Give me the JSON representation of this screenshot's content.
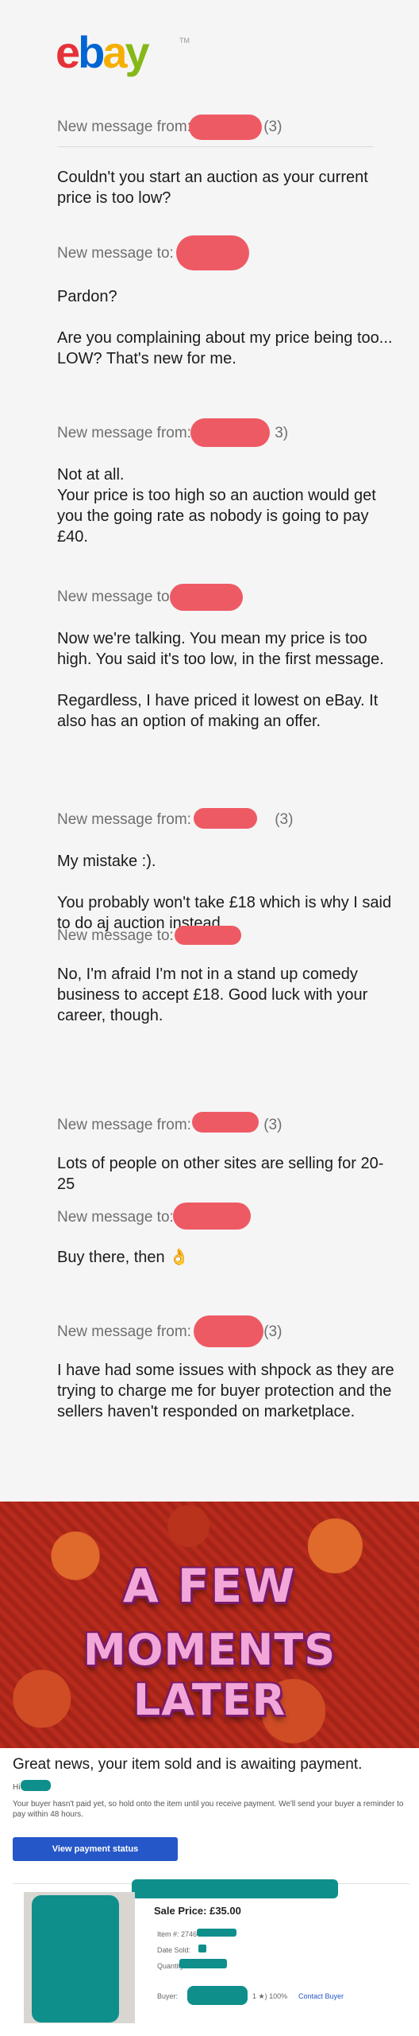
{
  "logo": {
    "letters": [
      "e",
      "b",
      "a",
      "y"
    ],
    "letter_colors": [
      "#e53238",
      "#0064d2",
      "#f5af02",
      "#86b817"
    ],
    "tm": "TM"
  },
  "conversation": [
    {
      "header": "New message from:",
      "suffix": "(3)",
      "text": "Couldn't you start an auction as your current price is too low?"
    },
    {
      "header": "New message to:",
      "suffix": "",
      "text": "Pardon?\n\nAre you complaining about my price being too... LOW? That's new for me."
    },
    {
      "header": "New message from:",
      "suffix": "3)",
      "text": "Not at all.\nYour price is too high so an auction would get you the going rate as nobody is going to pay £40."
    },
    {
      "header": "New message to:",
      "suffix": "",
      "text": "Now we're talking. You mean my price is too high. You said it's too low, in the first message.\n\nRegardless, I have priced it lowest on eBay. It also has an option of making an offer."
    },
    {
      "header": "New message from:",
      "suffix": "(3)",
      "text": "My mistake :).\n\nYou probably won't take £18 which is why I said to do aj auction instead."
    },
    {
      "header": "New message to:",
      "suffix": "",
      "text": "No, I'm afraid I'm not in a stand up comedy business to accept £18. Good luck with your career, though."
    },
    {
      "header": "New message from:",
      "suffix": "(3)",
      "text": "Lots of people on other sites are selling for 20-25"
    },
    {
      "header": "New message to:",
      "suffix": "",
      "text": "Buy there, then 👌"
    },
    {
      "header": "New message from:",
      "suffix": "(3)",
      "text": "I have had some issues with shpock as they are trying to charge me for buyer protection and the sellers haven't responded on marketplace."
    }
  ],
  "meme": {
    "line1": "A FEW",
    "line2": "MOMENTS LATER"
  },
  "sold": {
    "headline": "Great news, your item sold and is awaiting payment.",
    "greeting": "Hi",
    "note": "Your buyer hasn't paid yet, so hold onto the item until you receive payment. We'll send your buyer a reminder to pay within 48 hours.",
    "button": "View payment status",
    "price": "Sale Price: £35.00",
    "item_label": "Item #: 2746",
    "date_label": "Date Sold:",
    "quantity_label": "Quantity Sold: 1",
    "buyer_label": "Buyer:",
    "feedback": "1 ★) 100%",
    "contact": "Contact Buyer"
  },
  "colors": {
    "redaction_red": "#ee5a64",
    "redaction_teal": "#0f8f8c",
    "button_blue": "#2557c8"
  }
}
